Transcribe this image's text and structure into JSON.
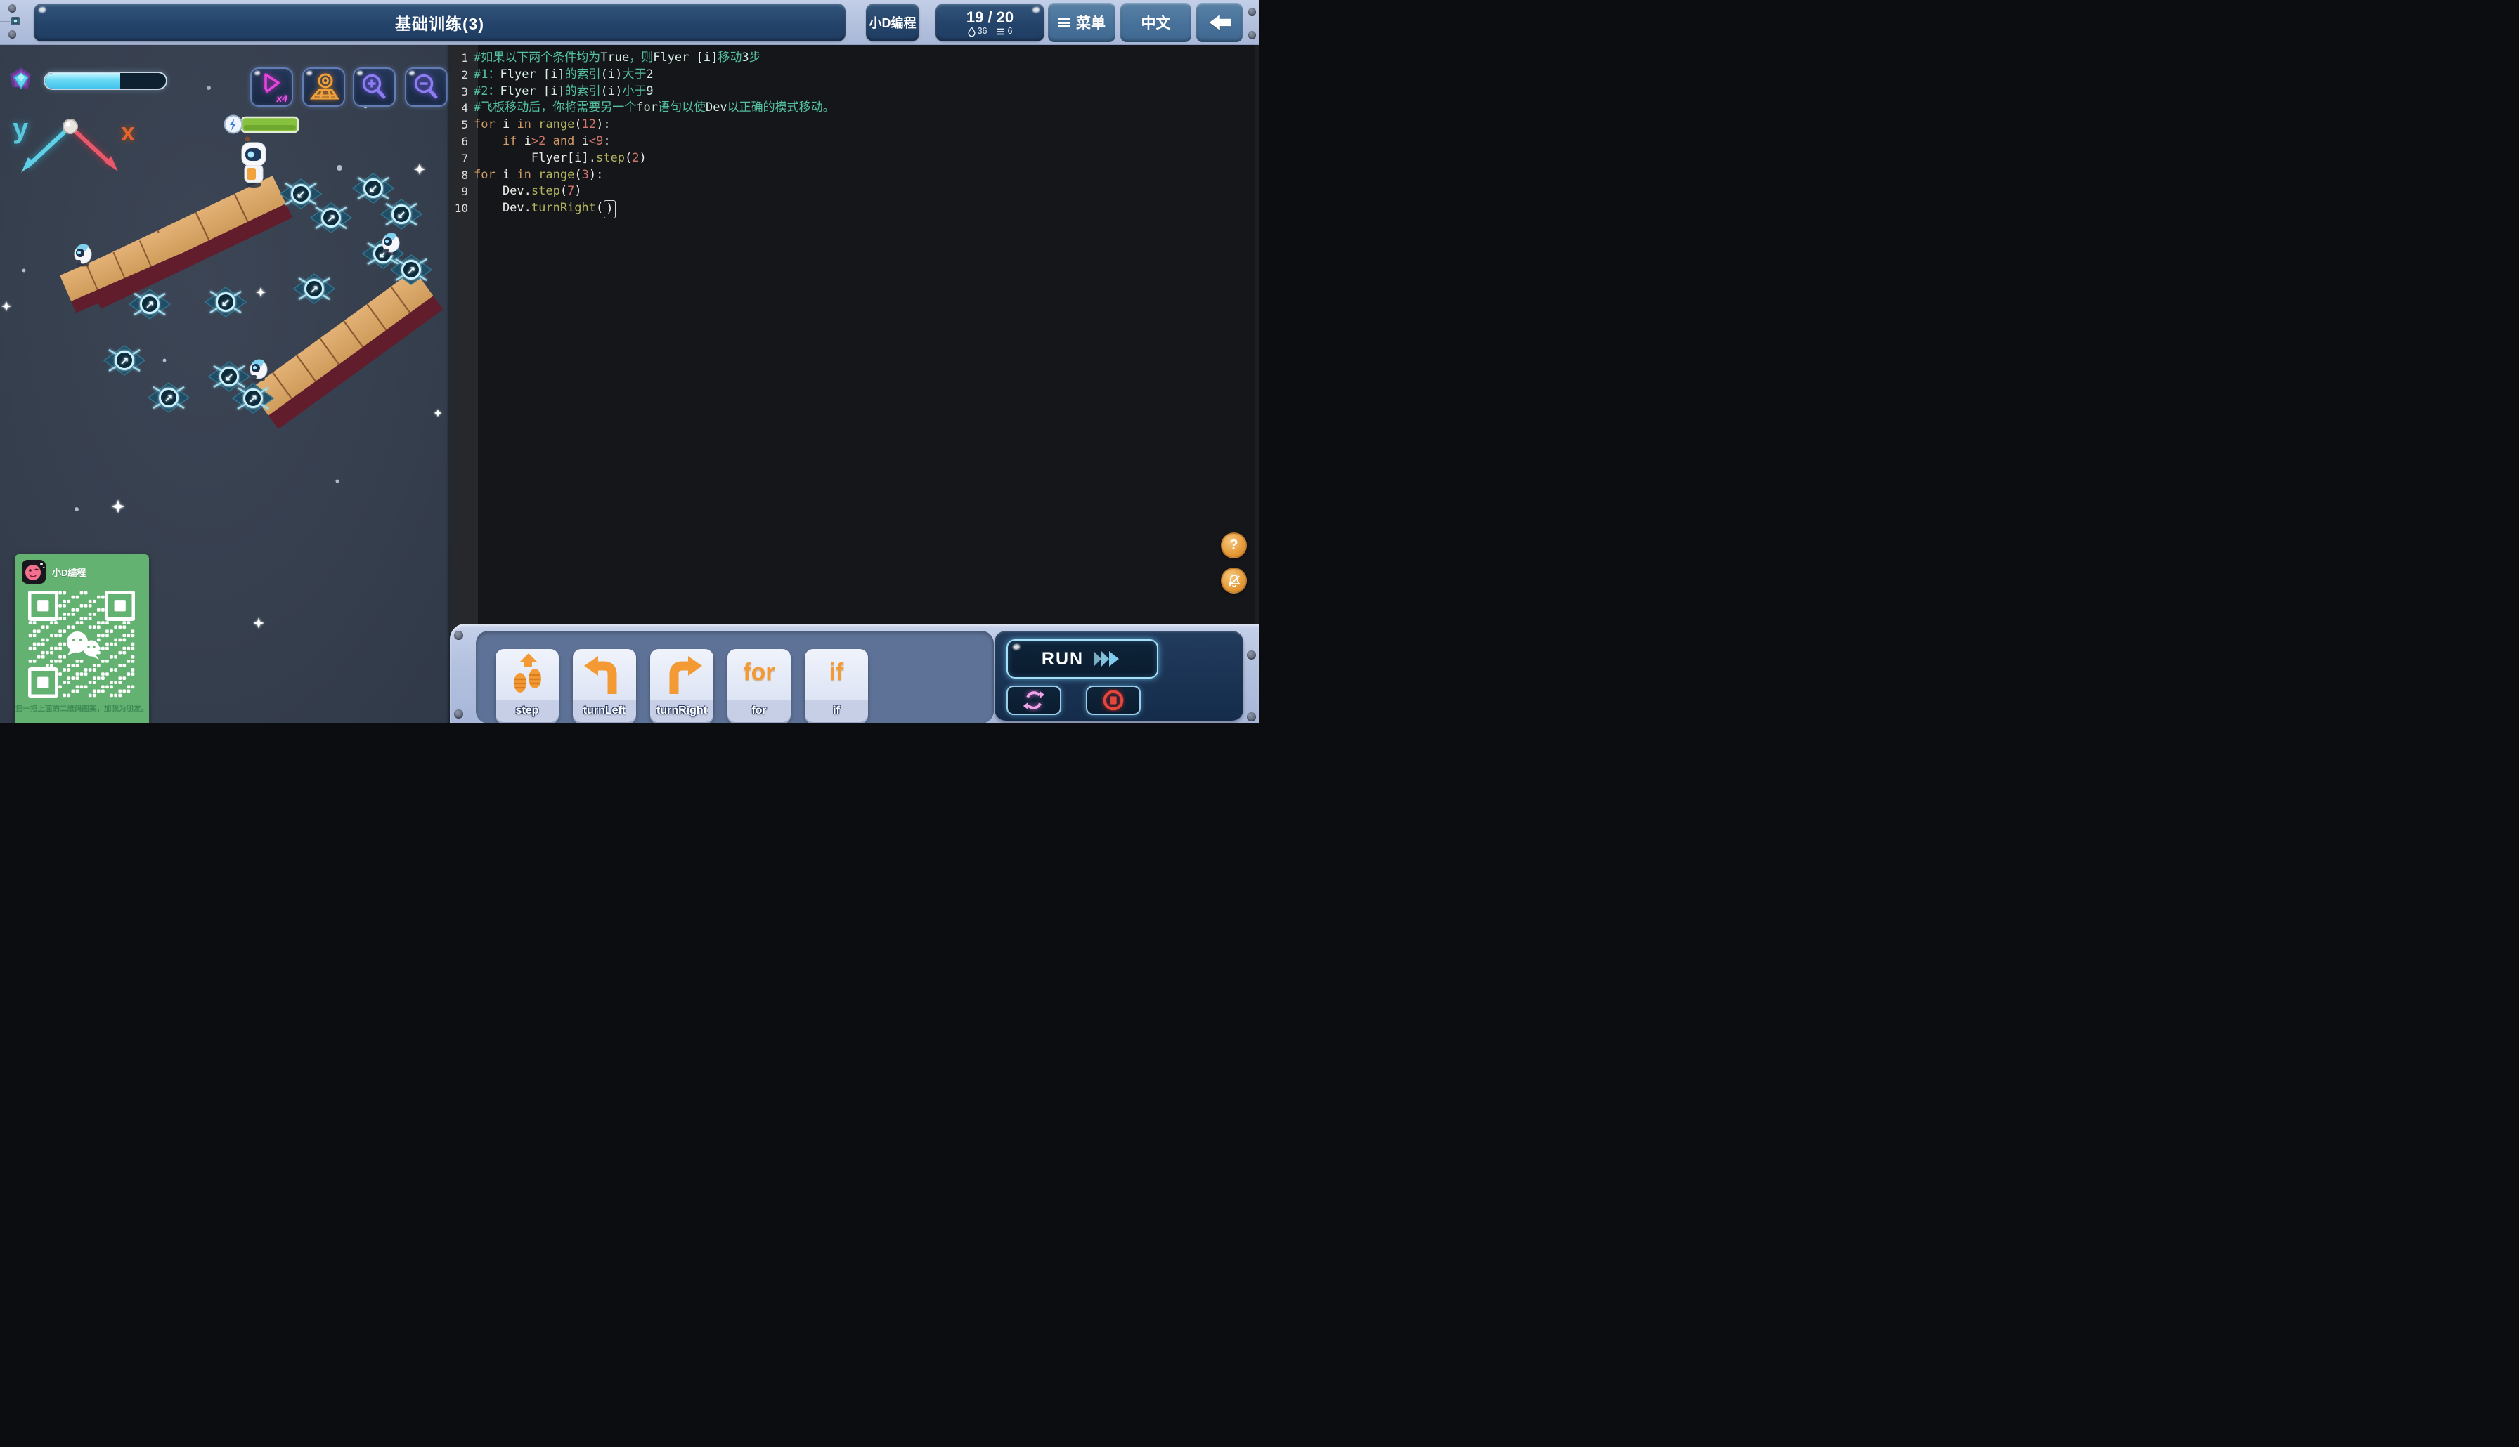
{
  "top_bar": {
    "title": "基础训练(3)",
    "brand_button": "小D编程",
    "score_button": {
      "score": "19 / 20",
      "drops": "36",
      "lines": "6"
    },
    "menu_button": "菜单",
    "language_button": "中文"
  },
  "hud": {
    "progress_percent": 62,
    "speed_label": "x4"
  },
  "axis": {
    "y": "y",
    "x": "x"
  },
  "dev": {
    "health_percent": 100
  },
  "editor": {
    "lines": [
      {
        "no": "1",
        "tokens": [
          [
            "c",
            "#如果以下两个条件均为"
          ],
          [
            "l",
            "True"
          ],
          [
            "c",
            "，则"
          ],
          [
            "l",
            "Flyer [i]"
          ],
          [
            "c",
            "移动"
          ],
          [
            "l",
            "3"
          ],
          [
            "c",
            "步"
          ]
        ]
      },
      {
        "no": "2",
        "tokens": [
          [
            "c",
            "#1："
          ],
          [
            "l",
            "Flyer [i]"
          ],
          [
            "c",
            "的索引"
          ],
          [
            "l",
            "(i)"
          ],
          [
            "c",
            "大于"
          ],
          [
            "l",
            "2"
          ]
        ]
      },
      {
        "no": "3",
        "tokens": [
          [
            "c",
            "#2："
          ],
          [
            "l",
            "Flyer [i]"
          ],
          [
            "c",
            "的索引"
          ],
          [
            "l",
            "(i)"
          ],
          [
            "c",
            "小于"
          ],
          [
            "l",
            "9"
          ]
        ]
      },
      {
        "no": "4",
        "tokens": [
          [
            "c",
            "#飞板移动后，你将需要另一个"
          ],
          [
            "l",
            "for"
          ],
          [
            "c",
            "语句以使"
          ],
          [
            "l",
            "Dev"
          ],
          [
            "c",
            "以正确的模式移动。"
          ]
        ]
      },
      {
        "no": "5",
        "tokens": [
          [
            "k",
            "for"
          ],
          [
            "p",
            " i "
          ],
          [
            "k",
            "in"
          ],
          [
            "p",
            " "
          ],
          [
            "f",
            "range"
          ],
          [
            "p",
            "("
          ],
          [
            "n",
            "12"
          ],
          [
            "p",
            "):"
          ]
        ]
      },
      {
        "no": "6",
        "tokens": [
          [
            "p",
            "    "
          ],
          [
            "k",
            "if"
          ],
          [
            "p",
            " i"
          ],
          [
            "n",
            ">2"
          ],
          [
            "p",
            " "
          ],
          [
            "k",
            "and"
          ],
          [
            "p",
            " i"
          ],
          [
            "n",
            "<9"
          ],
          [
            "p",
            ":"
          ]
        ]
      },
      {
        "no": "7",
        "tokens": [
          [
            "p",
            "        Flyer[i]."
          ],
          [
            "f",
            "step"
          ],
          [
            "p",
            "("
          ],
          [
            "n",
            "2"
          ],
          [
            "p",
            ")"
          ]
        ]
      },
      {
        "no": "8",
        "tokens": [
          [
            "k",
            "for"
          ],
          [
            "p",
            " i "
          ],
          [
            "k",
            "in"
          ],
          [
            "p",
            " "
          ],
          [
            "f",
            "range"
          ],
          [
            "p",
            "("
          ],
          [
            "n",
            "3"
          ],
          [
            "p",
            "):"
          ]
        ]
      },
      {
        "no": "9",
        "tokens": [
          [
            "p",
            "    Dev."
          ],
          [
            "f",
            "step"
          ],
          [
            "p",
            "("
          ],
          [
            "n",
            "7"
          ],
          [
            "p",
            ")"
          ]
        ]
      },
      {
        "no": "10",
        "tokens": [
          [
            "p",
            "    Dev."
          ],
          [
            "f",
            "turnRight"
          ],
          [
            "p",
            "("
          ],
          [
            "cur",
            ")"
          ]
        ]
      }
    ]
  },
  "toolbar": {
    "blocks": [
      {
        "id": "step",
        "label": "step"
      },
      {
        "id": "turnLeft",
        "label": "turnLeft"
      },
      {
        "id": "turnRight",
        "label": "turnRight"
      },
      {
        "id": "for",
        "label": "for"
      },
      {
        "id": "if",
        "label": "if"
      }
    ]
  },
  "run_panel": {
    "run_label": "RUN"
  },
  "side_buttons": {
    "help_label": "?"
  },
  "qr_card": {
    "title": "小D编程",
    "caption": "扫一扫上面的二维码图案，加我为朋友。"
  },
  "colors": {
    "accent_cyan": "#69d9f5",
    "accent_orange": "#f49a35",
    "accent_magenta": "#e545de",
    "accent_purple": "#8d7cf2",
    "comment_teal": "#54c0a0",
    "keyword_tan": "#d19a66",
    "number_salmon": "#d4776b",
    "wood": "#d9a767",
    "pad_teal": "#20506a",
    "qr_green": "#63b271"
  }
}
